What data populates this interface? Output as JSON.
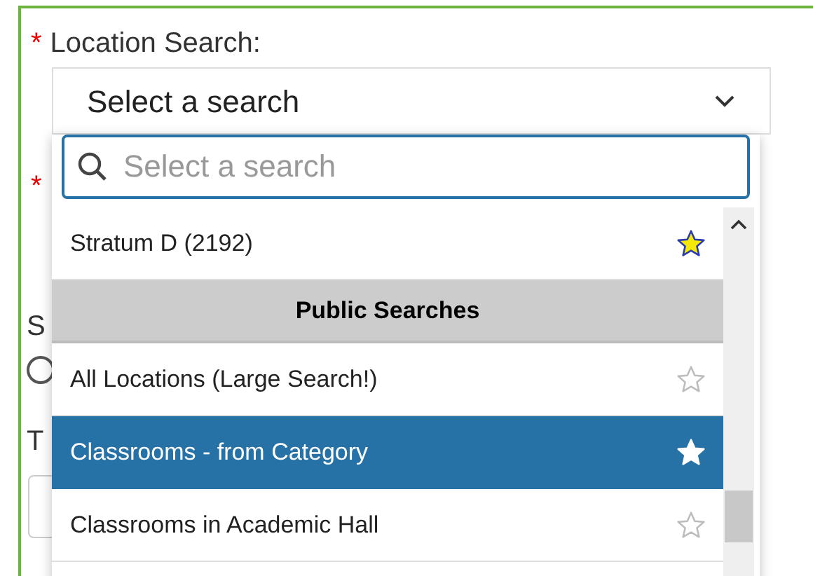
{
  "form": {
    "required_mark": "*",
    "label": "Location Search:",
    "second_required_mark": "*",
    "partial_label_1": "S",
    "radio_checked": false,
    "partial_label_2": "T"
  },
  "select": {
    "value": "Select a search",
    "search_placeholder": "Select a search",
    "options": [
      {
        "kind": "item",
        "label": "Stratum D (2192)",
        "favorite": true,
        "selected": false
      },
      {
        "kind": "header",
        "label": "Public Searches"
      },
      {
        "kind": "item",
        "label": "All Locations (Large Search!)",
        "favorite": false,
        "selected": false
      },
      {
        "kind": "item",
        "label": "Classrooms - from Category",
        "favorite": false,
        "selected": true
      },
      {
        "kind": "item",
        "label": "Classrooms in Academic Hall",
        "favorite": false,
        "selected": false
      }
    ]
  }
}
